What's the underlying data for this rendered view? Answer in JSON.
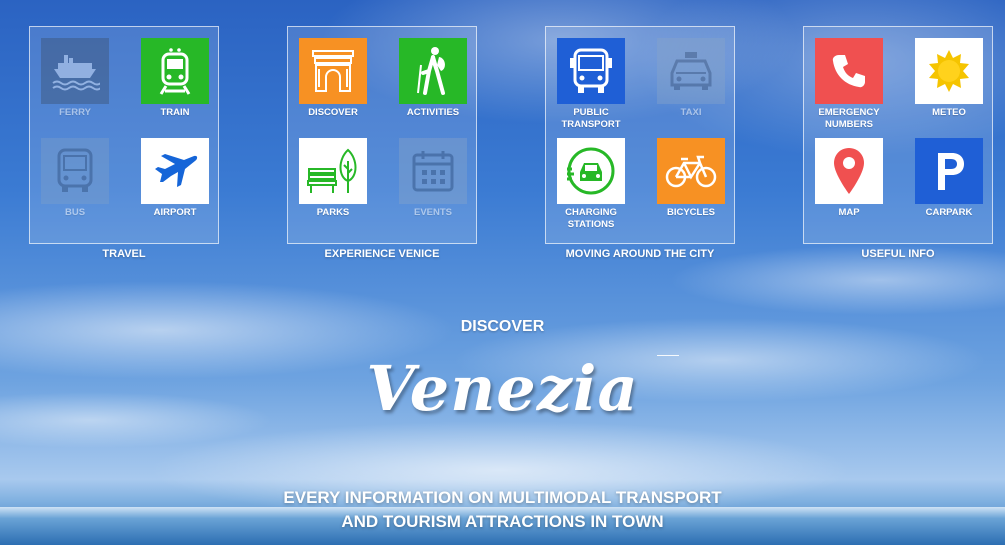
{
  "groups": [
    {
      "title": "TRAVEL",
      "tiles": [
        {
          "label": "FERRY",
          "icon": "ferry-icon",
          "color": "#3b4d66",
          "enabled": false
        },
        {
          "label": "TRAIN",
          "icon": "train-icon",
          "color": "#27b827",
          "enabled": true
        },
        {
          "label": "BUS",
          "icon": "bus-icon",
          "color": "#7fa0c8",
          "enabled": false
        },
        {
          "label": "AIRPORT",
          "icon": "airplane-icon",
          "color": "#ffffff",
          "enabled": true
        }
      ]
    },
    {
      "title": "EXPERIENCE VENICE",
      "tiles": [
        {
          "label": "DISCOVER",
          "icon": "arch-monument-icon",
          "color": "#f79123",
          "enabled": true
        },
        {
          "label": "ACTIVITIES",
          "icon": "hiker-icon",
          "color": "#27b827",
          "enabled": true
        },
        {
          "label": "PARKS",
          "icon": "park-bench-tree-icon",
          "color": "#ffffff",
          "enabled": true
        },
        {
          "label": "EVENTS",
          "icon": "calendar-icon",
          "color": "#8aa6c8",
          "enabled": false
        }
      ]
    },
    {
      "title": "MOVING AROUND THE CITY",
      "tiles": [
        {
          "label": "PUBLIC TRANSPORT",
          "icon": "bus-front-icon",
          "color": "#1f5fd6",
          "enabled": true
        },
        {
          "label": "TAXI",
          "icon": "taxi-icon",
          "color": "#8aa6c8",
          "enabled": false
        },
        {
          "label": "CHARGING STATIONS",
          "icon": "ev-charging-icon",
          "color": "#ffffff",
          "enabled": true
        },
        {
          "label": "BICYCLES",
          "icon": "bicycle-icon",
          "color": "#f79123",
          "enabled": true
        }
      ]
    },
    {
      "title": "USEFUL INFO",
      "tiles": [
        {
          "label": "EMERGENCY NUMBERS",
          "icon": "phone-icon",
          "color": "#f05050",
          "enabled": true
        },
        {
          "label": "METEO",
          "icon": "sun-icon",
          "color": "#ffffff",
          "enabled": true
        },
        {
          "label": "MAP",
          "icon": "map-pin-icon",
          "color": "#ffffff",
          "enabled": true
        },
        {
          "label": "CARPARK",
          "icon": "parking-icon",
          "color": "#1f5fd6",
          "enabled": true
        }
      ]
    }
  ],
  "hero": {
    "subtitle": "DISCOVER",
    "title": "Venezia",
    "tagline_line1": "EVERY INFORMATION ON MULTIMODAL TRANSPORT",
    "tagline_line2": "AND TOURISM ATTRACTIONS IN TOWN"
  }
}
